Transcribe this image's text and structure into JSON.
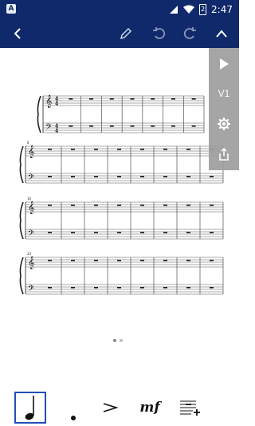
{
  "status_bar": {
    "app_badge": "A",
    "battery": "2",
    "time": "2:47"
  },
  "toolbar": {
    "back": "back-arrow-icon",
    "edit": "pencil-icon",
    "undo": "undo-icon",
    "redo": "redo-icon",
    "collapse": "chevron-up-icon"
  },
  "side_panel": {
    "play": "play-icon",
    "voice_label": "V1",
    "settings": "gear-icon",
    "share": "share-icon"
  },
  "score": {
    "time_signature_top": "4",
    "time_signature_bottom": "4",
    "systems": [
      {
        "measure_number": "",
        "measures": 7
      },
      {
        "measure_number": "8",
        "measures": 8
      },
      {
        "measure_number": "16",
        "measures": 8
      },
      {
        "measure_number": "24",
        "measures": 8
      }
    ]
  },
  "pager": {
    "pages": 2,
    "current": 1
  },
  "bottom_tools": [
    {
      "name": "quarter-note",
      "label": ""
    },
    {
      "name": "dot",
      "label": ""
    },
    {
      "name": "accent",
      "label": ""
    },
    {
      "name": "dynamic-mf",
      "label": "mf"
    },
    {
      "name": "add-staff",
      "label": ""
    }
  ],
  "colors": {
    "bar": "#10296b",
    "panel": "#9e9e9e",
    "selection": "#1f4fb4"
  }
}
